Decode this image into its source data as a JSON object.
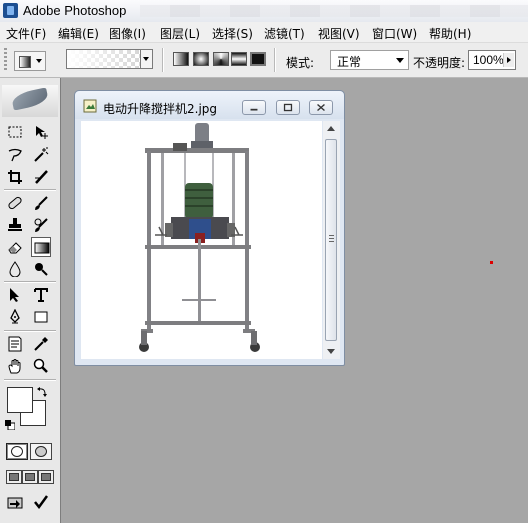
{
  "app": {
    "title": "Adobe Photoshop"
  },
  "menu": [
    {
      "label": "文件(F)"
    },
    {
      "label": "编辑(E)"
    },
    {
      "label": "图像(I)"
    },
    {
      "label": "图层(L)"
    },
    {
      "label": "选择(S)"
    },
    {
      "label": "滤镜(T)"
    },
    {
      "label": "视图(V)"
    },
    {
      "label": "窗口(W)"
    },
    {
      "label": "帮助(H)"
    }
  ],
  "options": {
    "mode_label": "模式:",
    "mode_value": "正常",
    "opacity_label": "不透明度:",
    "opacity_value": "100%",
    "gradient_types": [
      "linear",
      "radial",
      "angle",
      "reflected",
      "diamond"
    ],
    "selected_gradient_type": "diamond"
  },
  "document": {
    "title": "电动升降搅拌机2.jpg",
    "has_more": true
  },
  "toolbox": {
    "active_tool": "gradient-tool",
    "foreground_color": "#ffffff",
    "background_color": "#ffffff"
  },
  "colors": {
    "workspace": "#a6a6a6",
    "document_frame": "#dfe7f2",
    "machine_frame": "#7d7d80",
    "motor": "#3f5f3e"
  }
}
